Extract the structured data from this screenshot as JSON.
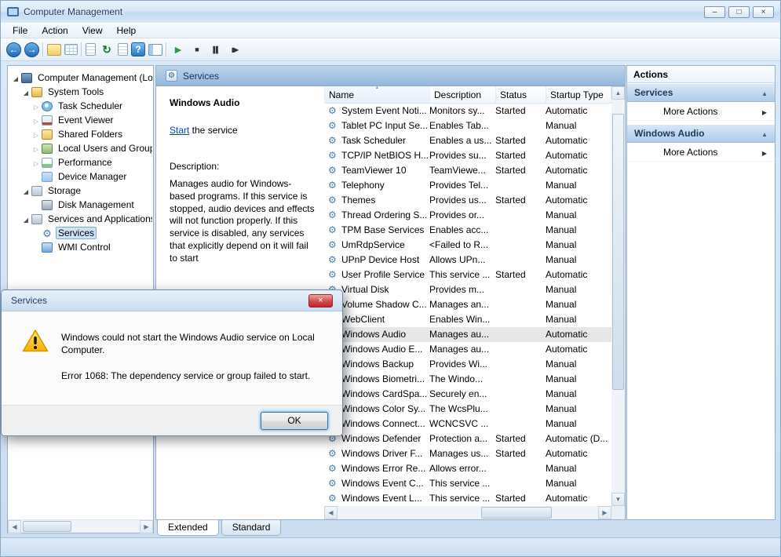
{
  "window": {
    "title": "Computer Management",
    "controls": [
      {
        "name": "minimize",
        "glyph": "–"
      },
      {
        "name": "maximize",
        "glyph": "□"
      },
      {
        "name": "close",
        "glyph": "×"
      }
    ]
  },
  "menubar": {
    "items": [
      "File",
      "Action",
      "View",
      "Help"
    ]
  },
  "toolbar": {
    "icons": [
      {
        "name": "back",
        "glyph": "←"
      },
      {
        "name": "forward",
        "glyph": "→"
      },
      {
        "name": "separator1",
        "glyph": ""
      },
      {
        "name": "show-console-tree",
        "glyph": ""
      },
      {
        "name": "export-list",
        "glyph": ""
      },
      {
        "name": "separator2",
        "glyph": ""
      },
      {
        "name": "doc-properties",
        "glyph": ""
      },
      {
        "name": "refresh",
        "glyph": "↻"
      },
      {
        "name": "export-doc",
        "glyph": ""
      },
      {
        "name": "help",
        "glyph": "?"
      },
      {
        "name": "toggle-pane",
        "glyph": ""
      },
      {
        "name": "separator3",
        "glyph": ""
      },
      {
        "name": "start-service",
        "glyph": "▶"
      },
      {
        "name": "stop-service",
        "glyph": "■"
      },
      {
        "name": "pause-service",
        "glyph": "▌▌"
      },
      {
        "name": "restart-service",
        "glyph": "▮▶"
      }
    ]
  },
  "tree": {
    "items": [
      {
        "label": "Computer Management (Local)",
        "level": 0,
        "expand": "expanded",
        "icon": "computer",
        "selected": false
      },
      {
        "label": "System Tools",
        "level": 1,
        "expand": "expanded",
        "icon": "system-tools",
        "selected": false
      },
      {
        "label": "Task Scheduler",
        "level": 2,
        "expand": "collapsed",
        "icon": "task-scheduler",
        "selected": false
      },
      {
        "label": "Event Viewer",
        "level": 2,
        "expand": "collapsed",
        "icon": "event-viewer",
        "selected": false
      },
      {
        "label": "Shared Folders",
        "level": 2,
        "expand": "collapsed",
        "icon": "shared-folders",
        "selected": false
      },
      {
        "label": "Local Users and Groups",
        "level": 2,
        "expand": "collapsed",
        "icon": "local-users",
        "selected": false
      },
      {
        "label": "Performance",
        "level": 2,
        "expand": "collapsed",
        "icon": "performance",
        "selected": false
      },
      {
        "label": "Device Manager",
        "level": 2,
        "expand": "none",
        "icon": "device-manager",
        "selected": false
      },
      {
        "label": "Storage",
        "level": 1,
        "expand": "expanded",
        "icon": "storage",
        "selected": false
      },
      {
        "label": "Disk Management",
        "level": 2,
        "expand": "none",
        "icon": "disk-management",
        "selected": false
      },
      {
        "label": "Services and Applications",
        "level": 1,
        "expand": "expanded",
        "icon": "services-apps",
        "selected": false
      },
      {
        "label": "Services",
        "level": 2,
        "expand": "none",
        "icon": "services",
        "selected": true
      },
      {
        "label": "WMI Control",
        "level": 2,
        "expand": "none",
        "icon": "wmi",
        "selected": false
      }
    ]
  },
  "services_pane": {
    "header": "Services",
    "service_name": "Windows Audio",
    "start_link_text": "Start",
    "start_line_rest": " the service",
    "description_label": "Description:",
    "description_text": "Manages audio for Windows-based programs. If this service is stopped, audio devices and effects will not function properly. If this service is disabled, any services that explicitly depend on it will fail to start"
  },
  "services_table": {
    "columns": [
      "Name",
      "Description",
      "Status",
      "Startup Type"
    ],
    "rows": [
      {
        "name": "System Event Noti...",
        "description": "Monitors sy...",
        "status": "Started",
        "startup": "Automatic",
        "selected": false
      },
      {
        "name": "Tablet PC Input Se...",
        "description": "Enables Tab...",
        "status": "",
        "startup": "Manual",
        "selected": false
      },
      {
        "name": "Task Scheduler",
        "description": "Enables a us...",
        "status": "Started",
        "startup": "Automatic",
        "selected": false
      },
      {
        "name": "TCP/IP NetBIOS H...",
        "description": "Provides su...",
        "status": "Started",
        "startup": "Automatic",
        "selected": false
      },
      {
        "name": "TeamViewer 10",
        "description": "TeamViewe...",
        "status": "Started",
        "startup": "Automatic",
        "selected": false
      },
      {
        "name": "Telephony",
        "description": "Provides Tel...",
        "status": "",
        "startup": "Manual",
        "selected": false
      },
      {
        "name": "Themes",
        "description": "Provides us...",
        "status": "Started",
        "startup": "Automatic",
        "selected": false
      },
      {
        "name": "Thread Ordering S...",
        "description": "Provides or...",
        "status": "",
        "startup": "Manual",
        "selected": false
      },
      {
        "name": "TPM Base Services",
        "description": "Enables acc...",
        "status": "",
        "startup": "Manual",
        "selected": false
      },
      {
        "name": "UmRdpService",
        "description": "<Failed to R...",
        "status": "",
        "startup": "Manual",
        "selected": false
      },
      {
        "name": "UPnP Device Host",
        "description": "Allows UPn...",
        "status": "",
        "startup": "Manual",
        "selected": false
      },
      {
        "name": "User Profile Service",
        "description": "This service ...",
        "status": "Started",
        "startup": "Automatic",
        "selected": false
      },
      {
        "name": "Virtual Disk",
        "description": "Provides m...",
        "status": "",
        "startup": "Manual",
        "selected": false
      },
      {
        "name": "Volume Shadow C...",
        "description": "Manages an...",
        "status": "",
        "startup": "Manual",
        "selected": false
      },
      {
        "name": "WebClient",
        "description": "Enables Win...",
        "status": "",
        "startup": "Manual",
        "selected": false
      },
      {
        "name": "Windows Audio",
        "description": "Manages au...",
        "status": "",
        "startup": "Automatic",
        "selected": true
      },
      {
        "name": "Windows Audio E...",
        "description": "Manages au...",
        "status": "",
        "startup": "Automatic",
        "selected": false
      },
      {
        "name": "Windows Backup",
        "description": "Provides Wi...",
        "status": "",
        "startup": "Manual",
        "selected": false
      },
      {
        "name": "Windows Biometri...",
        "description": "The Windo...",
        "status": "",
        "startup": "Manual",
        "selected": false
      },
      {
        "name": "Windows CardSpa...",
        "description": "Securely en...",
        "status": "",
        "startup": "Manual",
        "selected": false
      },
      {
        "name": "Windows Color Sy...",
        "description": "The WcsPlu...",
        "status": "",
        "startup": "Manual",
        "selected": false
      },
      {
        "name": "Windows Connect...",
        "description": "WCNCSVC ...",
        "status": "",
        "startup": "Manual",
        "selected": false
      },
      {
        "name": "Windows Defender",
        "description": "Protection a...",
        "status": "Started",
        "startup": "Automatic (D...",
        "selected": false
      },
      {
        "name": "Windows Driver F...",
        "description": "Manages us...",
        "status": "Started",
        "startup": "Automatic",
        "selected": false
      },
      {
        "name": "Windows Error Re...",
        "description": "Allows error...",
        "status": "",
        "startup": "Manual",
        "selected": false
      },
      {
        "name": "Windows Event C...",
        "description": "This service ...",
        "status": "",
        "startup": "Manual",
        "selected": false
      },
      {
        "name": "Windows Event L...",
        "description": "This service ...",
        "status": "Started",
        "startup": "Automatic",
        "selected": false
      }
    ]
  },
  "dialog": {
    "title": "Services",
    "close_glyph": "×",
    "message_line1": "Windows could not start the Windows Audio service on Local Computer.",
    "message_line2": "Error 1068: The dependency service or group failed to start.",
    "ok_label": "OK"
  },
  "actions_pane": {
    "title": "Actions",
    "sections": [
      {
        "header": "Services",
        "more": "More Actions"
      },
      {
        "header": "Windows Audio",
        "more": "More Actions"
      }
    ]
  },
  "tabs": {
    "items": [
      "Extended",
      "Standard"
    ],
    "active": "Extended"
  }
}
